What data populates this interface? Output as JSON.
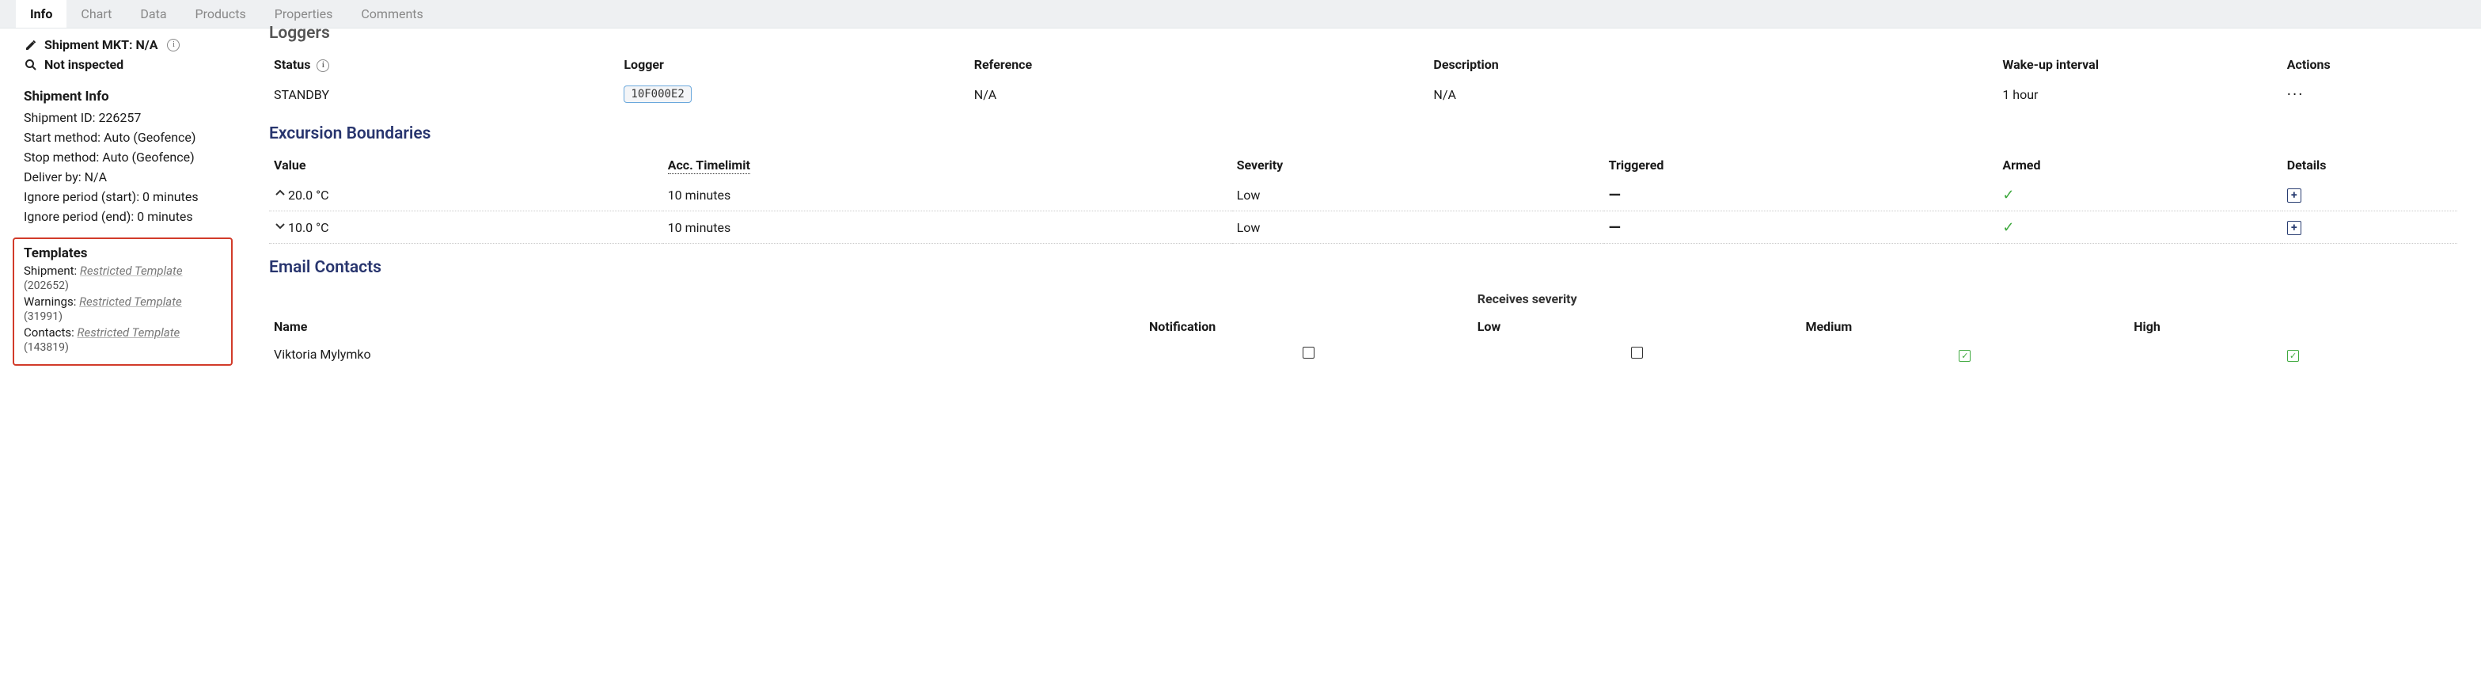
{
  "tabs": [
    "Info",
    "Chart",
    "Data",
    "Products",
    "Properties",
    "Comments"
  ],
  "activeTab": 0,
  "sidebar": {
    "mkt_label": "Shipment MKT: N/A",
    "inspected_label": "Not inspected",
    "shipment_info_title": "Shipment Info",
    "lines": {
      "id": "Shipment ID: 226257",
      "start": "Start method: Auto (Geofence)",
      "stop": "Stop method: Auto (Geofence)",
      "deliver": "Deliver by: N/A",
      "ignore_start": "Ignore period (start): 0 minutes",
      "ignore_end": "Ignore period (end): 0 minutes"
    },
    "templates": {
      "title": "Templates",
      "shipment_label": "Shipment:",
      "shipment_link": "Restricted Template",
      "shipment_id": "(202652)",
      "warnings_label": "Warnings:",
      "warnings_link": "Restricted Template",
      "warnings_id": "(31991)",
      "contacts_label": "Contacts:",
      "contacts_link": "Restricted Template",
      "contacts_id": "(143819)"
    }
  },
  "loggers": {
    "title": "Loggers",
    "headers": {
      "status": "Status",
      "logger": "Logger",
      "reference": "Reference",
      "description": "Description",
      "wakeup": "Wake-up interval",
      "actions": "Actions"
    },
    "row": {
      "status": "STANDBY",
      "logger": "10F000E2",
      "reference": "N/A",
      "description": "N/A",
      "wakeup": "1 hour"
    }
  },
  "excursion": {
    "title": "Excursion Boundaries",
    "headers": {
      "value": "Value",
      "acc": "Acc. Timelimit",
      "severity": "Severity",
      "triggered": "Triggered",
      "armed": "Armed",
      "details": "Details"
    },
    "rows": [
      {
        "dir": "up",
        "value": "20.0 °C",
        "acc": "10 minutes",
        "severity": "Low"
      },
      {
        "dir": "down",
        "value": "10.0 °C",
        "acc": "10 minutes",
        "severity": "Low"
      }
    ]
  },
  "contacts": {
    "title": "Email Contacts",
    "receives_label": "Receives severity",
    "headers": {
      "name": "Name",
      "notification": "Notification",
      "low": "Low",
      "medium": "Medium",
      "high": "High"
    },
    "row": {
      "name": "Viktoria Mylymko",
      "notification": false,
      "low": false,
      "medium": true,
      "high": true
    }
  }
}
